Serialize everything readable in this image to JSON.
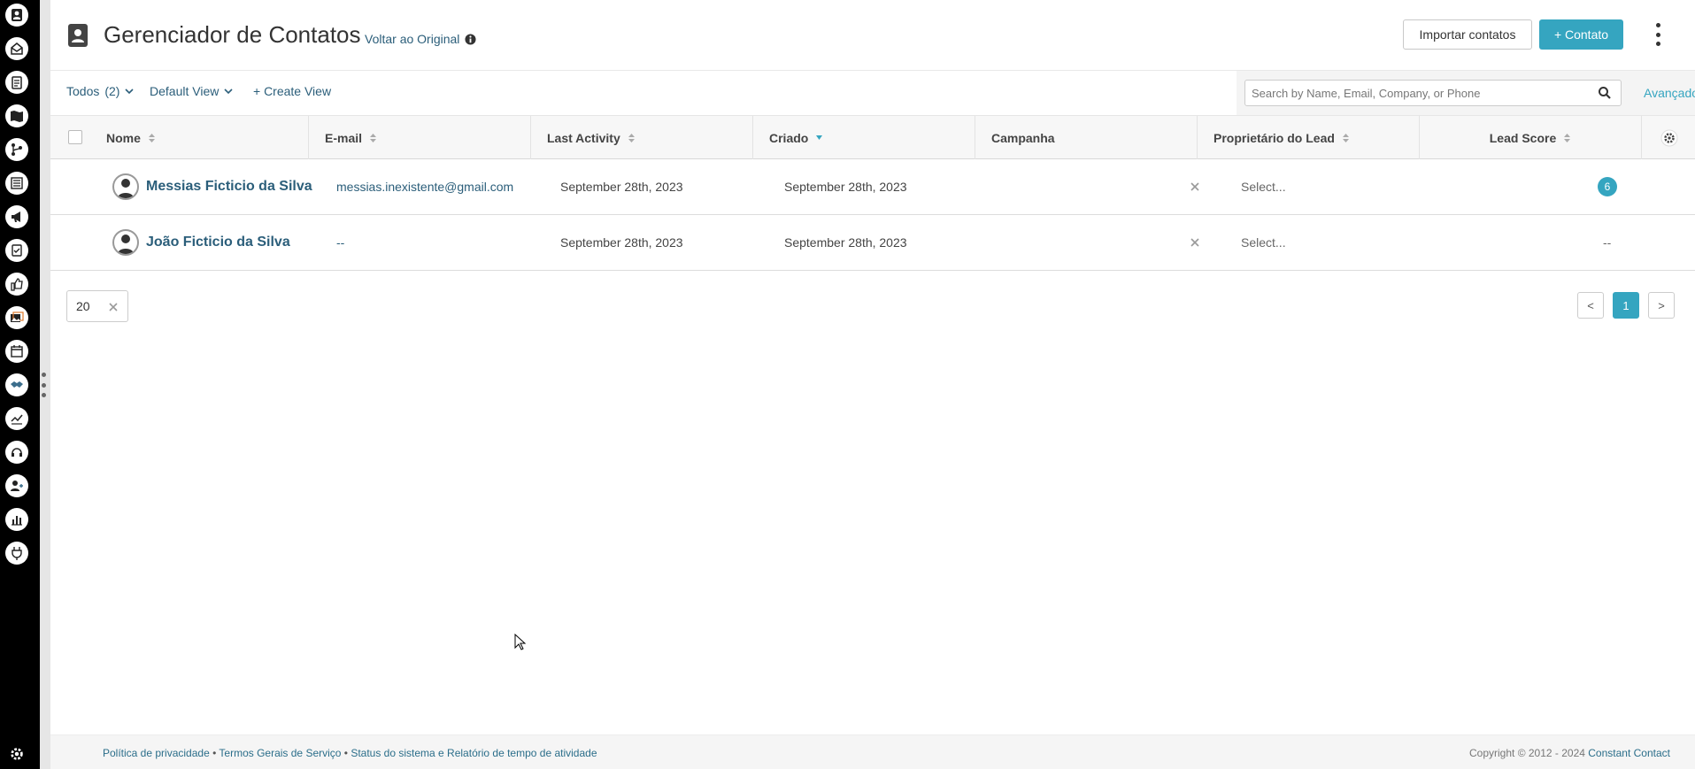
{
  "rail": {
    "items": [
      {
        "icon": "contacts-icon"
      },
      {
        "icon": "inbox-icon"
      },
      {
        "icon": "tasks-icon"
      },
      {
        "icon": "playbook-icon"
      },
      {
        "icon": "workflow-icon"
      },
      {
        "icon": "list-icon"
      },
      {
        "icon": "campaign-megaphone-icon"
      },
      {
        "icon": "forms-icon"
      },
      {
        "icon": "social-like-icon"
      },
      {
        "icon": "media-icon"
      },
      {
        "icon": "calendar-icon"
      },
      {
        "icon": "deals-handshake-icon"
      },
      {
        "icon": "analytics-icon"
      },
      {
        "icon": "support-headset-icon"
      },
      {
        "icon": "user-add-icon"
      },
      {
        "icon": "reports-icon"
      },
      {
        "icon": "integrations-plug-icon"
      }
    ],
    "settings_icon": "gear-icon"
  },
  "header": {
    "title": "Gerenciador de Contatos",
    "revert_link": "Voltar ao Original",
    "import_button": "Importar contatos",
    "add_button": "+ Contato"
  },
  "toolbar": {
    "filter_label": "Todos",
    "filter_count": "(2)",
    "view_label": "Default View",
    "create_view": "+ Create View",
    "search_placeholder": "Search by Name, Email, Company, or Phone",
    "advanced": "Avançado"
  },
  "table": {
    "columns": {
      "name": "Nome",
      "email": "E-mail",
      "last_activity": "Last Activity",
      "created": "Criado",
      "campaign": "Campanha",
      "owner": "Proprietário do Lead",
      "score": "Lead Score"
    },
    "rows": [
      {
        "name": "Messias Ficticio da Silva",
        "email": "messias.inexistente@gmail.com",
        "last_activity": "September 28th, 2023",
        "created": "September 28th, 2023",
        "owner": "Select...",
        "score": "6"
      },
      {
        "name": "João Ficticio da Silva",
        "email": "--",
        "last_activity": "September 28th, 2023",
        "created": "September 28th, 2023",
        "owner": "Select...",
        "score": "--"
      }
    ]
  },
  "pagination": {
    "per_page": "20",
    "prev": "<",
    "current": "1",
    "next": ">"
  },
  "footer": {
    "privacy": "Política de privacidade",
    "sep1": " • ",
    "terms": "Termos Gerais de Serviço",
    "sep2": " • ",
    "status": "Status do sistema e Relatório de tempo de atividade",
    "copyright": "Copyright © 2012 - 2024 ",
    "brand": "Constant Contact"
  },
  "colors": {
    "accent": "#35a5c0",
    "link": "#2b5e7a",
    "rail": "#000000"
  }
}
